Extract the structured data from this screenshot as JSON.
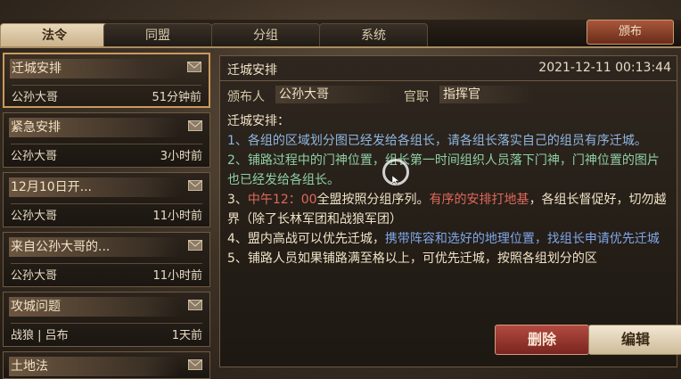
{
  "tabs": [
    {
      "label": "法令",
      "active": true
    },
    {
      "label": "同盟",
      "active": false
    },
    {
      "label": "分组",
      "active": false
    },
    {
      "label": "系统",
      "active": false
    }
  ],
  "publish_button": "颁布",
  "list_items": [
    {
      "title": "迁城安排",
      "author": "公孙大哥",
      "time": "51分钟前",
      "icon": "mail-icon",
      "selected": true
    },
    {
      "title": "紧急安排",
      "author": "公孙大哥",
      "time": "3小时前",
      "icon": "mail-icon",
      "selected": false
    },
    {
      "title": "12月10日开...",
      "author": "公孙大哥",
      "time": "11小时前",
      "icon": "mail-icon",
      "selected": false
    },
    {
      "title": "来自公孙大哥的...",
      "author": "公孙大哥",
      "time": "11小时前",
      "icon": "mail-icon",
      "selected": false
    },
    {
      "title": "攻城问题",
      "author": "战狼 | 吕布",
      "time": "1天前",
      "icon": "mail-icon",
      "selected": false
    },
    {
      "title": "土地法",
      "author": "",
      "time": "",
      "icon": "mail-icon",
      "selected": false
    }
  ],
  "detail": {
    "title": "迁城安排",
    "date": "2021-12-11 00:13:44",
    "publisher_label": "颁布人",
    "publisher": "公孙大哥",
    "role_label": "官职",
    "role": "指挥官",
    "content_heading": "迁城安排：",
    "p1": "1、各组的区域划分图已经发给各组长，请各组长落实自己的组员有序迁城。",
    "p2": "2、铺路过程中的门神位置，组长第一时间组织人员落下门神，门神位置的图片也已经发给各组长。",
    "p3_a": "3、",
    "p3_b": "中午12：00",
    "p3_c": "全盟按照分组序列。",
    "p3_d": "有序的安排打地基",
    "p3_e": "，各组长督促好，切勿越界（除了长林军团和战狼军团）",
    "p4_a": "4、盟内高战可以优先迁城，",
    "p4_b": "携带阵容和选好的地理位置，找组长申请优先迁城",
    "p5": "5、铺路人员如果铺路满至格以上，可优先迁城，按照各组划分的区"
  },
  "buttons": {
    "delete": "删除",
    "edit": "编辑"
  },
  "colors": {
    "accent": "#c99a5c",
    "delete": "#b24a40",
    "blue_text": "#8fb6e0",
    "green_text": "#8fcfa4",
    "red_text": "#e0685a"
  }
}
